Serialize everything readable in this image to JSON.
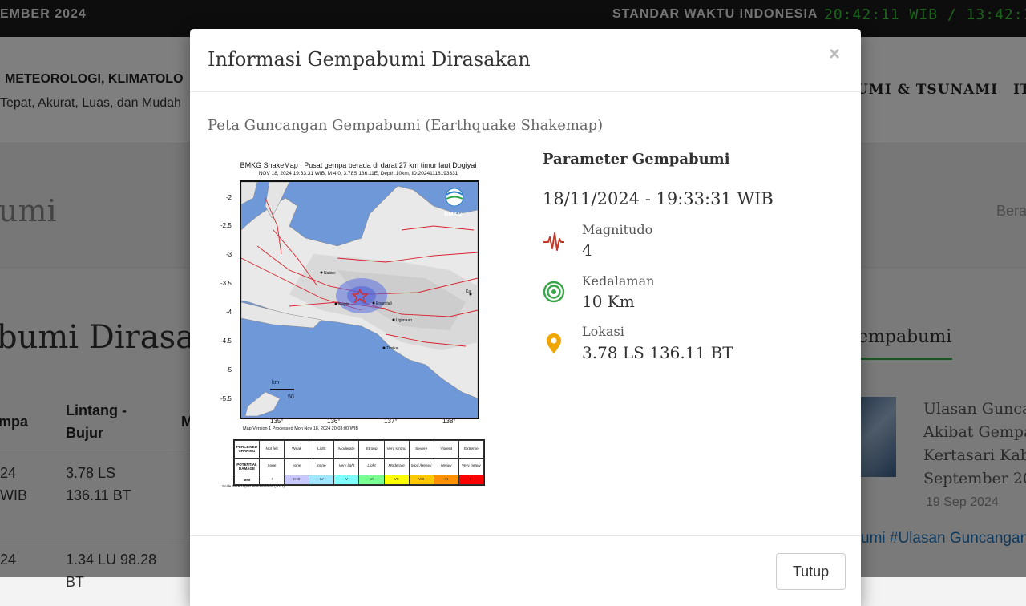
{
  "topbar": {
    "date": "EMBER 2024",
    "std_label": "STANDAR WAKTU INDONESIA",
    "clock": "20:42:11 WIB / 13:42:11 U"
  },
  "header": {
    "org": "METEOROLOGI, KLIMATOLO",
    "tagline": "Tepat, Akurat, Luas, dan Mudah",
    "nav_quake": "UMI & TSUNAMI",
    "nav_it": "IT"
  },
  "band": {
    "title": "umi",
    "crumb": "Bera"
  },
  "page": {
    "heading": "bumi Dirasak",
    "side_heading": "empabumi"
  },
  "table": {
    "col_time": "mpa",
    "col_latlon_1": "Lintang -",
    "col_latlon_2": "Bujur",
    "col_m": "M",
    "rows": [
      {
        "time_1": "24",
        "time_2": "WIB",
        "lat": "3.78 LS",
        "lon": "136.11 BT"
      },
      {
        "time_1": "24",
        "lat": "1.34 LU 98.28",
        "lon": "BT"
      }
    ]
  },
  "news": {
    "title_lines": [
      "Ulasan Gunca",
      "Akibat Gempa",
      "Kertasari Kab.",
      "September 20"
    ],
    "date": "19 Sep 2024",
    "tags": "umi #Ulasan Guncangan"
  },
  "modal": {
    "title": "Informasi Gempabumi Dirasakan",
    "close": "×",
    "subtitle": "Peta Guncangan Gempabumi (Earthquake Shakemap)",
    "params_title": "Parameter Gempabumi",
    "datetime": "18/11/2024 - 19:33:31 WIB",
    "magnitude_label": "Magnitudo",
    "magnitude": "4",
    "depth_label": "Kedalaman",
    "depth": "10 Km",
    "location_label": "Lokasi",
    "location": "3.78 LS 136.11 BT",
    "close_button": "Tutup"
  },
  "shakemap": {
    "caption_1": "BMKG ShakeMap : Pusat gempa berada di darat 27 km timur laut Dogiyai",
    "caption_2": "NOV 18, 2024 19:33:31 WIB, M:4.0, 3.78S 136.11E, Depth:10km, ID:20241118193331",
    "logo_text": "BMKG",
    "y_labels": [
      "-2",
      "-2.5",
      "-3",
      "-3.5",
      "-4",
      "-4.5",
      "-5",
      "-5.5"
    ],
    "x_labels": [
      "135°",
      "136°",
      "137°",
      "138°"
    ],
    "scale_unit": "km",
    "scale_value": "50",
    "version": "Map Version 1 Processed Mon Nov 18, 2024 20:03:00 WIB",
    "legend_rows": {
      "perceived": [
        "PERCEIVED SHAKING",
        "Not felt",
        "Weak",
        "Light",
        "Moderate",
        "Strong",
        "Very strong",
        "Severe",
        "Violent",
        "Extreme"
      ],
      "damage": [
        "POTENTIAL DAMAGE",
        "none",
        "none",
        "none",
        "Very light",
        "Light",
        "Moderate",
        "Mod./Heavy",
        "Heavy",
        "Very heavy"
      ],
      "mmi": [
        "MMI",
        "I",
        "II-III",
        "IV",
        "V",
        "VI",
        "VII",
        "VIII",
        "IX",
        "X+"
      ]
    },
    "mmi_colors": [
      "#ffffff",
      "#c8c8ff",
      "#a0e6ff",
      "#80ffff",
      "#7aff93",
      "#ffff00",
      "#ffc800",
      "#ff9100",
      "#ff0000",
      "#c80000"
    ],
    "scale_note": "Scale based upon Worden et al. (2011)",
    "towns": [
      "Nabire",
      "Enarotali",
      "Mapia",
      "Ugimaan",
      "Timika",
      "Kai"
    ]
  },
  "colors": {
    "accent": "#3aa54a",
    "magnitude_icon": "#c0392b",
    "depth_icon": "#3aa54a",
    "location_icon": "#f0a500"
  }
}
